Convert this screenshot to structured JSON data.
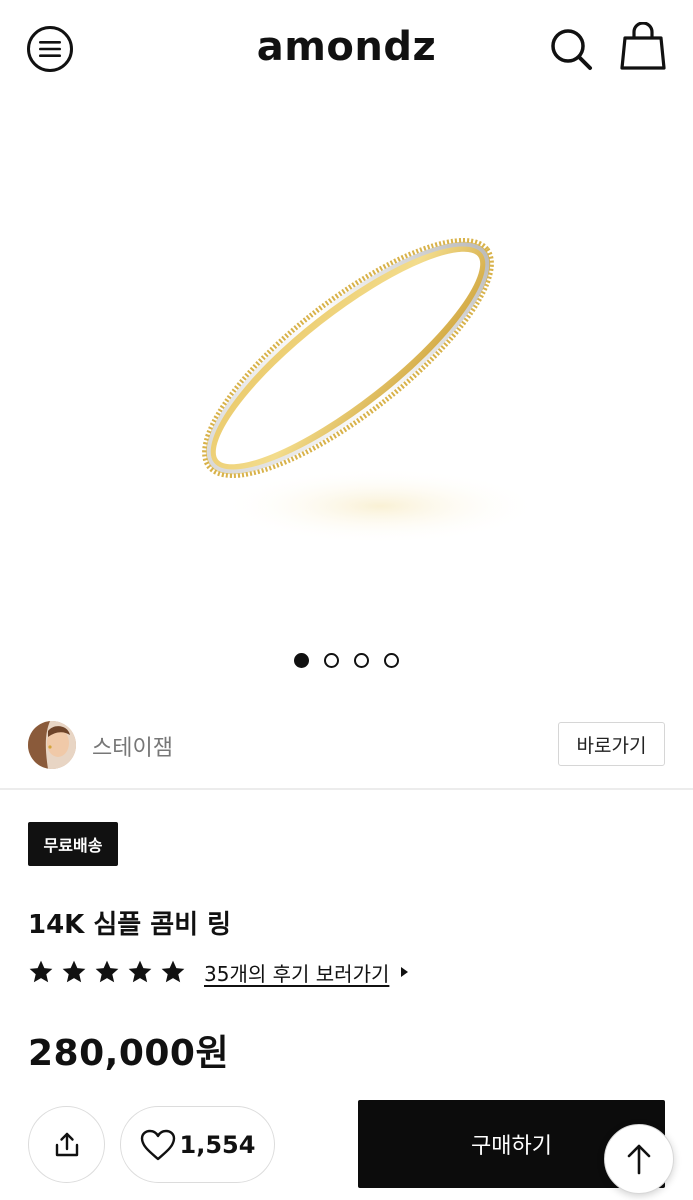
{
  "header": {
    "logo": "amondz",
    "menu_icon": "hamburger-menu-icon",
    "search_icon": "search-icon",
    "cart_icon": "shopping-bag-icon"
  },
  "gallery": {
    "image_alt": "gold and white gold combination ring",
    "dots_total": 4,
    "active_index": 0
  },
  "seller": {
    "name": "스테이잼",
    "button_label": "바로가기"
  },
  "product": {
    "badge": "무료배송",
    "title": "14K 심플 콤비 링",
    "rating_stars": 5,
    "review_link": "35개의 후기 보러가기",
    "price": "280,000원"
  },
  "actions": {
    "share_icon": "share-icon",
    "like_icon": "heart-icon",
    "like_count": "1,554",
    "buy_label": "구매하기",
    "top_icon": "arrow-up-icon"
  }
}
